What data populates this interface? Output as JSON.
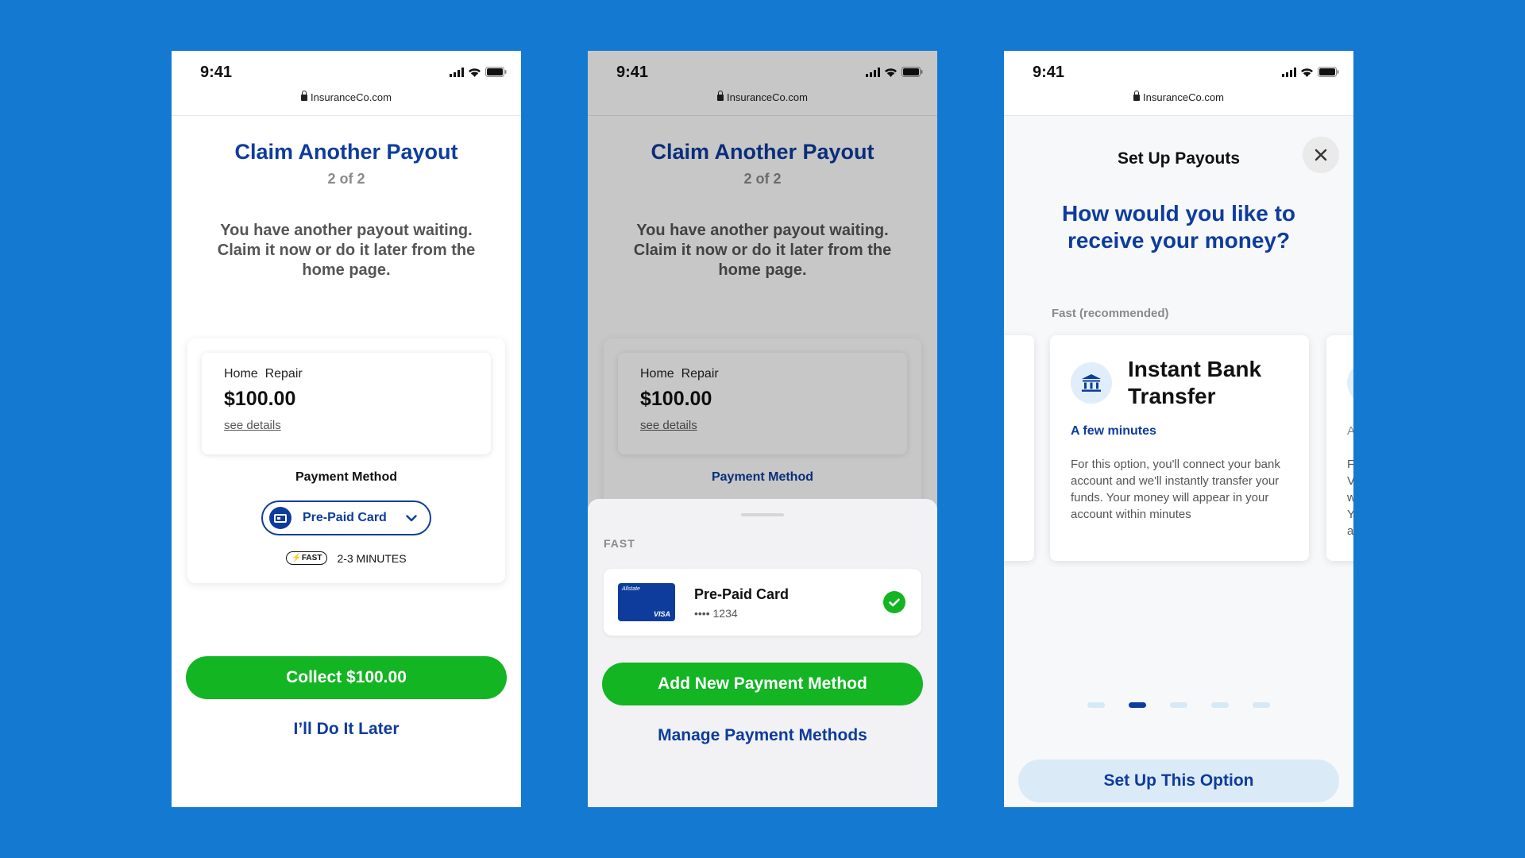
{
  "status_bar": {
    "time": "9:41",
    "url": "InsuranceCo.com"
  },
  "claim": {
    "title": "Claim Another Payout",
    "step": "2 of 2",
    "message": "You have another payout waiting. Claim it now or do it later from the home page.",
    "payout_label": "Home  Repair",
    "payout_amount": "$100.00",
    "details_link": "see details",
    "payment_method_label": "Payment Method",
    "selected_method": "Pre-Paid Card",
    "fast_badge": "FAST",
    "eta": "2-3 MINUTES",
    "collect_button": "Collect $100.00",
    "later_link": "I’ll Do It Later"
  },
  "sheet": {
    "section_label": "FAST",
    "card_brand": "Allstate",
    "card_network": "VISA",
    "card_name": "Pre-Paid Card",
    "card_number": "•••• 1234",
    "add_button": "Add New Payment Method",
    "manage_link": "Manage Payment Methods"
  },
  "setup": {
    "title": "Set Up Payouts",
    "question": "How would you like to receive your money?",
    "option_label": "Fast (recommended)",
    "option": {
      "name": "Instant Bank Transfer",
      "speed": "A few minutes",
      "description": "For this option, you'll connect your bank account and we'll instantly transfer your funds. Your money will appear in your account within minutes",
      "icon": "bank-icon"
    },
    "peek_left_letter": "o",
    "peek_right_letters": [
      "A",
      "F",
      "V",
      "w",
      "Y",
      "a"
    ],
    "carousel": {
      "total": 5,
      "active": 2
    },
    "setup_button": "Set Up This Option"
  },
  "colors": {
    "background": "#1479d0",
    "brand_blue": "#0d3c9c",
    "green": "#13b523",
    "light_blue": "#dbeaf7"
  }
}
